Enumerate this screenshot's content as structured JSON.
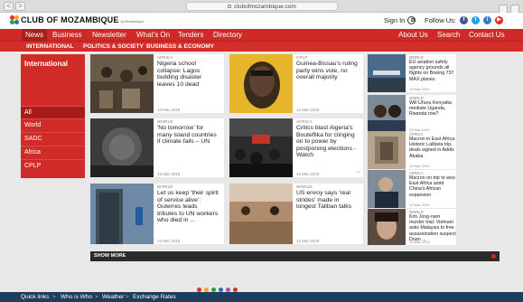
{
  "browser": {
    "url": "clubofmozambique.com",
    "back_glyph": "<",
    "forward_glyph": ">"
  },
  "header": {
    "logo_title": "CLUB OF MOZAMBIQUE",
    "logo_sub": "by Mozambique",
    "sign_in": "Sign In",
    "follow_us": "Follow Us:",
    "social": [
      {
        "name": "facebook",
        "glyph": "f",
        "color": "#3b5998"
      },
      {
        "name": "twitter",
        "glyph": "t",
        "color": "#1da1f2"
      },
      {
        "name": "instagram",
        "glyph": "i",
        "color": "#3b7bbf"
      },
      {
        "name": "youtube",
        "glyph": "▶",
        "color": "#e02a20"
      }
    ]
  },
  "mainnav": {
    "items": [
      "News",
      "Business",
      "Newsletter",
      "What's On",
      "Tenders",
      "Directory"
    ],
    "right_items": [
      "About Us",
      "Search",
      "Contact Us"
    ],
    "active": "News"
  },
  "subnav": {
    "items": [
      "INTERNATIONAL",
      "POLITICS & SOCIETY",
      "BUSINESS & ECONOMY"
    ]
  },
  "sidebar": {
    "title": "International",
    "items": [
      "All",
      "World",
      "SADC",
      "Africa",
      "CPLP"
    ],
    "active": "All"
  },
  "articles": [
    {
      "tag": "AFRICA",
      "headline": "Nigeria school collapse: Lagos building disaster leaves 10 dead",
      "date": "13 Mar 2019"
    },
    {
      "tag": "CPLP",
      "headline": "Guinea-Bissau's ruling party wins vote, no overall majority",
      "date": "13 Mar 2019"
    },
    {
      "tag": "WORLD",
      "headline": "'No tomorrow' for many island countries if climate fails – UN",
      "date": "13 Mar 2019"
    },
    {
      "tag": "AFRICA",
      "headline": "Critics blast Algeria's Bouteflika for clinging on to power by postponing elections - Watch",
      "date": "13 Mar 2019"
    },
    {
      "tag": "WORLD",
      "headline": "Let us keep 'their spirit of service alive': Guterres leads tributes to UN workers who died in ...",
      "date": "13 Mar 2019"
    },
    {
      "tag": "WORLD",
      "headline": "US envoy says 'real strides' made in longest Taliban talks",
      "date": "13 Mar 2019"
    }
  ],
  "right_articles": [
    {
      "tag": "WORLD",
      "headline": "EU aviation safety agency grounds all flights on Boeing 737 MAX planes",
      "date": "13 Mar 2019"
    },
    {
      "tag": "WORLD",
      "headline": "Will Uhuru Kenyatta mediate Uganda, Rwanda row?",
      "date": "13 Mar 2019"
    },
    {
      "tag": "AFRICA",
      "headline": "Macron in East Africa: Historic Lalibela trip, deals signed in Addis Ababa",
      "date": "13 Mar 2019"
    },
    {
      "tag": "AFRICA",
      "headline": "Macron on trip to woo East Africa amid China's African expansion",
      "date": "13 Mar 2019"
    },
    {
      "tag": "WORLD",
      "headline": "Kim Jong-nam murder trial: Vietnam asks Malaysia to free assassination suspect Doan ...",
      "date": "13 Mar 2019"
    }
  ],
  "show_more": "SHOW MORE",
  "footer": {
    "items": [
      "Quick links",
      "Who is Who",
      "Weather",
      "Exchange Rates"
    ],
    "separator": ">"
  },
  "colors": {
    "brand_red": "#cf2a27",
    "sidebar_active": "#a51c19",
    "footer_blue": "#1d3d5e"
  }
}
